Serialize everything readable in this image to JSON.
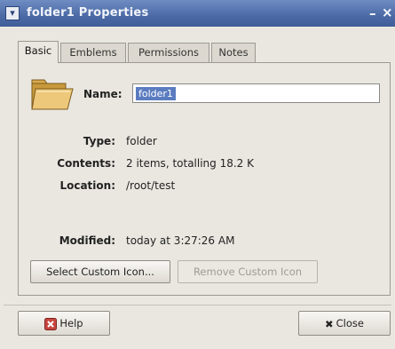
{
  "window": {
    "title": "folder1 Properties",
    "menu_icon": "chevron-down-icon",
    "minimize_glyph": "–",
    "close_glyph": "×"
  },
  "tabs": [
    {
      "label": "Basic",
      "active": true
    },
    {
      "label": "Emblems",
      "active": false
    },
    {
      "label": "Permissions",
      "active": false
    },
    {
      "label": "Notes",
      "active": false
    }
  ],
  "basic": {
    "icon": "folder-icon",
    "name_label": "Name:",
    "name_value": "folder1",
    "properties": [
      {
        "label": "Type:",
        "value": "folder"
      },
      {
        "label": "Contents:",
        "value": "2 items, totalling 18.2 K"
      },
      {
        "label": "Location:",
        "value": "/root/test"
      },
      {
        "label": "Modified:",
        "value": "today at 3:27:26 AM"
      }
    ],
    "select_icon_button": "Select Custom Icon...",
    "remove_icon_button": "Remove Custom Icon"
  },
  "footer": {
    "help_label": "Help",
    "help_icon": "help-icon",
    "close_label": "Close",
    "close_icon": "close-icon"
  },
  "colors": {
    "titlebar": "#4b6aa6",
    "selection": "#5b7cc0",
    "window_bg": "#eae7e1"
  }
}
